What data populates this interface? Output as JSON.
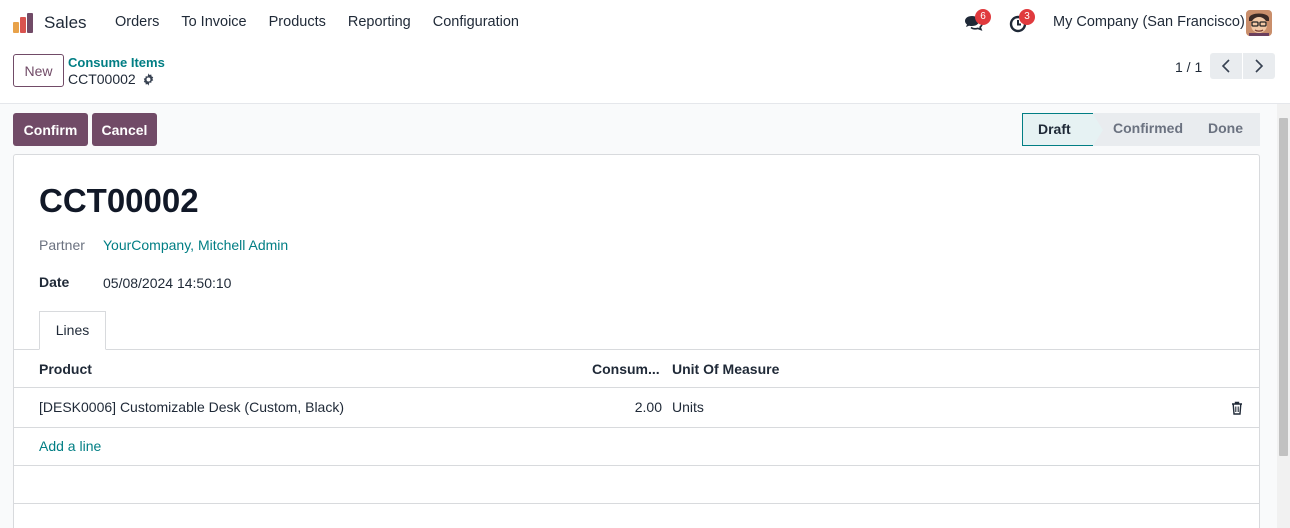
{
  "app": {
    "name": "Sales"
  },
  "menu": [
    {
      "label": "Orders"
    },
    {
      "label": "To Invoice"
    },
    {
      "label": "Products"
    },
    {
      "label": "Reporting"
    },
    {
      "label": "Configuration"
    }
  ],
  "systray": {
    "messages_count": "6",
    "activities_count": "3",
    "company": "My Company (San Francisco)"
  },
  "control": {
    "new_label": "New",
    "breadcrumb": "Consume Items",
    "record": "CCT00002",
    "pager": "1 / 1"
  },
  "actions": {
    "confirm": "Confirm",
    "cancel": "Cancel"
  },
  "statusbar": {
    "states": [
      {
        "label": "Draft",
        "active": true
      },
      {
        "label": "Confirmed",
        "active": false
      },
      {
        "label": "Done",
        "active": false
      }
    ]
  },
  "form": {
    "title": "CCT00002",
    "partner_label": "Partner",
    "partner_value": "YourCompany, Mitchell Admin",
    "date_label": "Date",
    "date_value": "05/08/2024 14:50:10",
    "tab": "Lines",
    "table": {
      "headers": [
        "Product",
        "Consum...",
        "Unit Of Measure"
      ],
      "rows": [
        {
          "product": "[DESK0006] Customizable Desk (Custom, Black)",
          "qty": "2.00",
          "uom": "Units"
        }
      ],
      "add_line": "Add a line"
    }
  },
  "colors": {
    "brand": "#714b67",
    "link": "#017e84",
    "badge": "#e03a3e"
  },
  "icons": [
    "app-logo-icon",
    "chat-icon",
    "clock-icon",
    "avatar",
    "gear-icon",
    "chevron-left-icon",
    "chevron-right-icon",
    "trash-icon"
  ]
}
